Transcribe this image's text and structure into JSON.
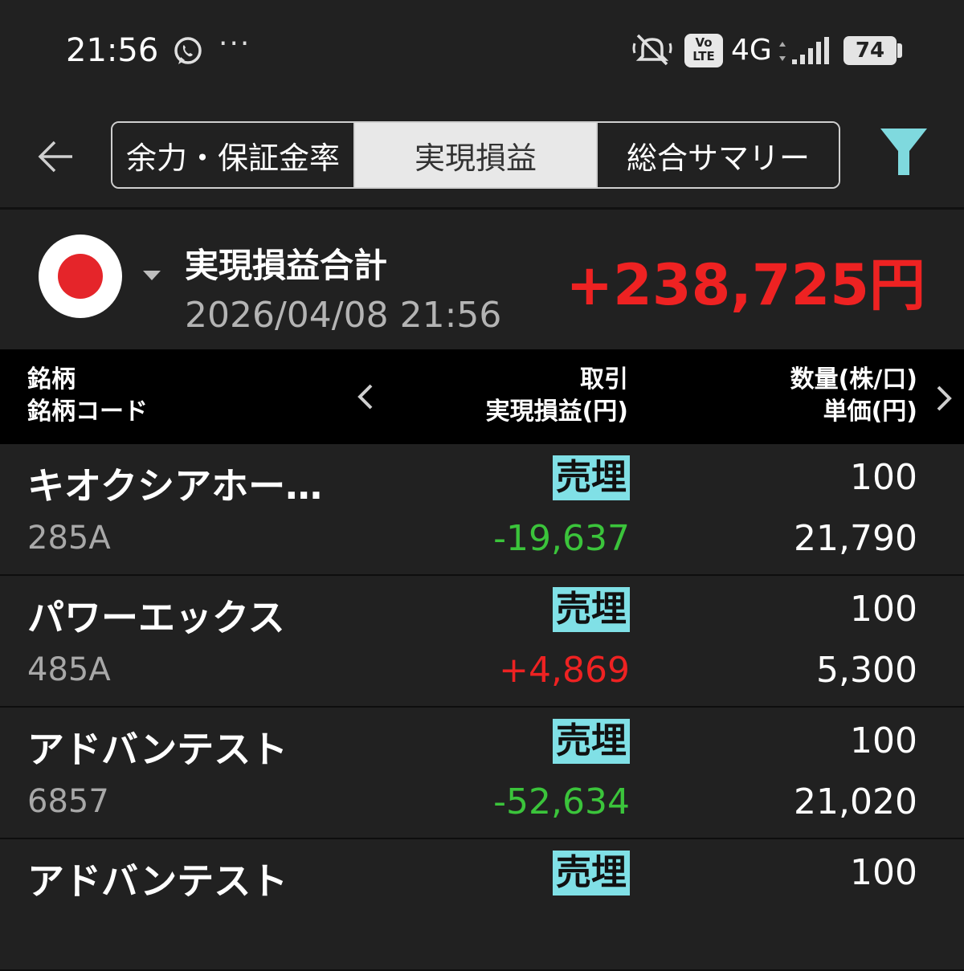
{
  "status_bar": {
    "time": "21:56",
    "more": "···",
    "volte": [
      "Vo",
      "LTE"
    ],
    "network": "4G",
    "battery": "74",
    "icons": [
      "whatsapp-icon",
      "mute-icon",
      "signal-icon",
      "battery-icon"
    ]
  },
  "header": {
    "tabs": [
      {
        "label": "余力・保証金率",
        "active": false
      },
      {
        "label": "実現損益",
        "active": true
      },
      {
        "label": "総合サマリー",
        "active": false
      }
    ],
    "colors": {
      "filter": "#7fd9de",
      "accent_positive": "#ee2222",
      "accent_negative": "#3bc43b"
    }
  },
  "summary": {
    "title": "実現損益合計",
    "datetime": "2026/04/08  21:56",
    "total": "+238,725円"
  },
  "columns": {
    "left": [
      "銘柄",
      "銘柄コード"
    ],
    "middle": [
      "取引",
      "実現損益(円)"
    ],
    "right": [
      "数量(株/口)",
      "単価(円)"
    ]
  },
  "rows": [
    {
      "name": "キオクシアホー…",
      "code": "285A",
      "type": "売埋",
      "pl": "-19,637",
      "pl_sign": "neg",
      "qty": "100",
      "price": "21,790"
    },
    {
      "name": "パワーエックス",
      "code": "485A",
      "type": "売埋",
      "pl": "+4,869",
      "pl_sign": "pos",
      "qty": "100",
      "price": "5,300"
    },
    {
      "name": "アドバンテスト",
      "code": "6857",
      "type": "売埋",
      "pl": "-52,634",
      "pl_sign": "neg",
      "qty": "100",
      "price": "21,020"
    },
    {
      "name": "アドバンテスト",
      "code": "",
      "type": "売埋",
      "pl": "",
      "pl_sign": "neg",
      "qty": "100",
      "price": ""
    }
  ]
}
